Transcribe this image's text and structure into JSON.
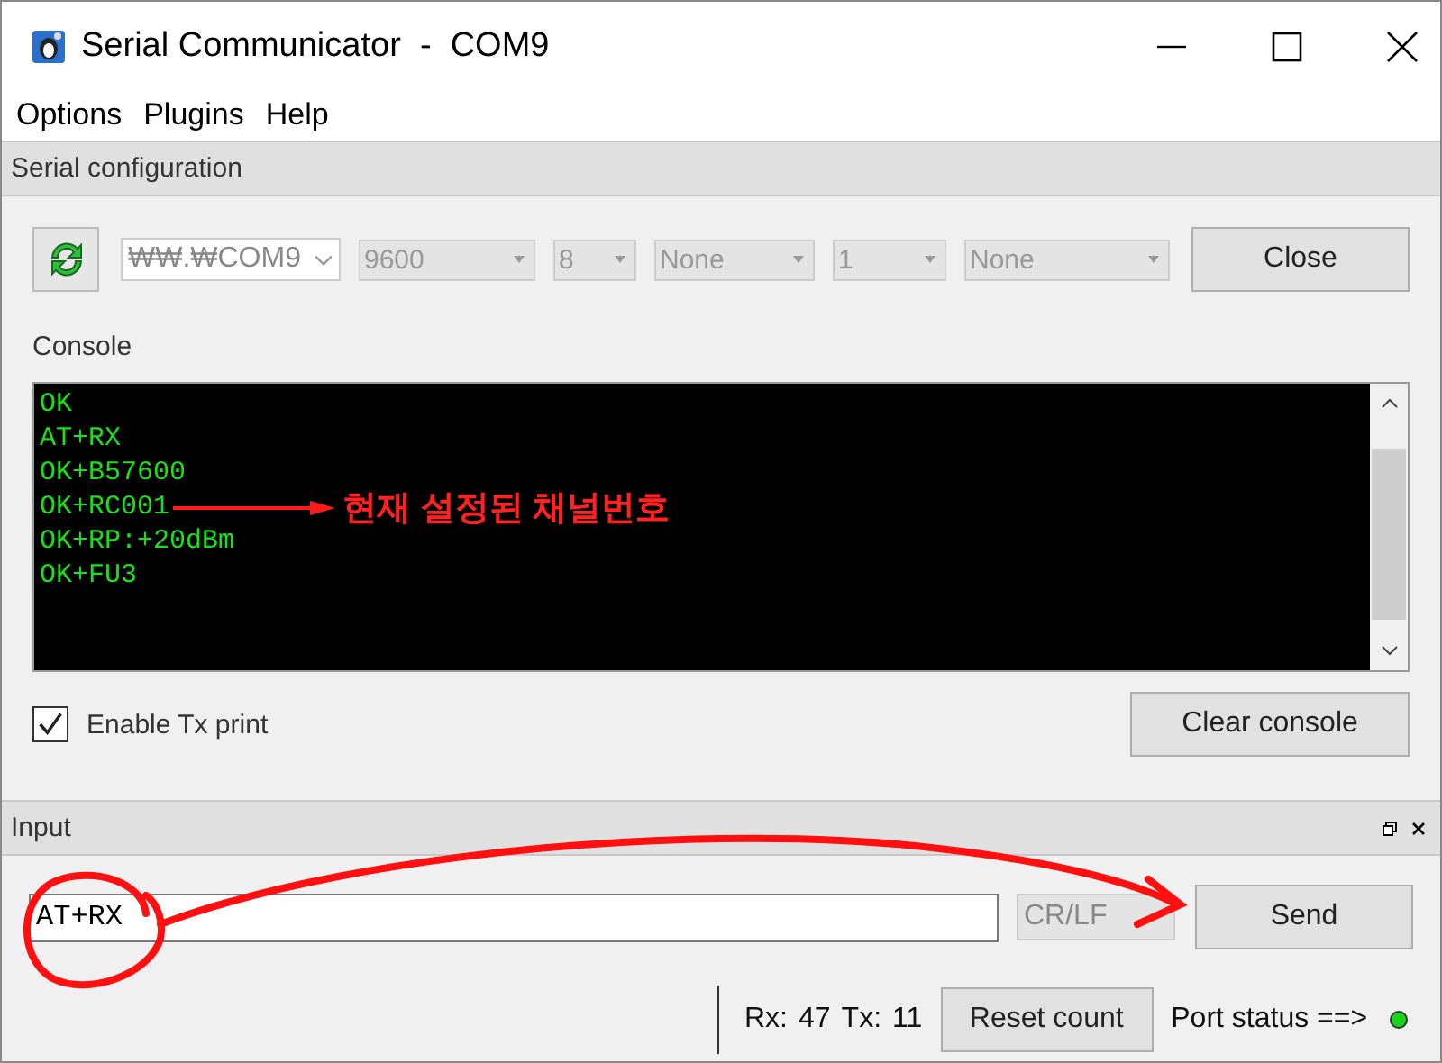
{
  "window": {
    "title": "Serial Communicator  -  COM9"
  },
  "menu": [
    {
      "label": "Options"
    },
    {
      "label": "Plugins"
    },
    {
      "label": "Help"
    }
  ],
  "serial_configuration": {
    "title": "Serial configuration",
    "port": "₩₩.₩COM9",
    "settings": [
      {
        "value": "9600",
        "disabled": true
      },
      {
        "value": "8",
        "disabled": true
      },
      {
        "value": "None",
        "disabled": true
      },
      {
        "value": "1",
        "disabled": true
      },
      {
        "value": "None",
        "disabled": true
      }
    ],
    "close_button": "Close"
  },
  "console": {
    "title": "Console",
    "lines": [
      {
        "text": "OK"
      },
      {
        "text": "AT+RX"
      },
      {
        "text": "OK+B57600"
      },
      {
        "text": "OK+RC001",
        "annotation": "현재 설정된 채널번호"
      },
      {
        "text": "OK+RP:+20dBm"
      },
      {
        "text": "OK+FU3"
      }
    ],
    "enable_tx_print": {
      "label": "Enable Tx print",
      "checked": true
    },
    "clear_button": "Clear console"
  },
  "input": {
    "title": "Input",
    "value": "AT+RX",
    "line_ending": "CR/LF",
    "send_button": "Send"
  },
  "status_bar": {
    "rx_label": "Rx:",
    "rx_count": "47",
    "tx_label": "Tx:",
    "tx_count": "11",
    "reset_button": "Reset count",
    "port_status": "Port status ==>",
    "connected": true
  }
}
